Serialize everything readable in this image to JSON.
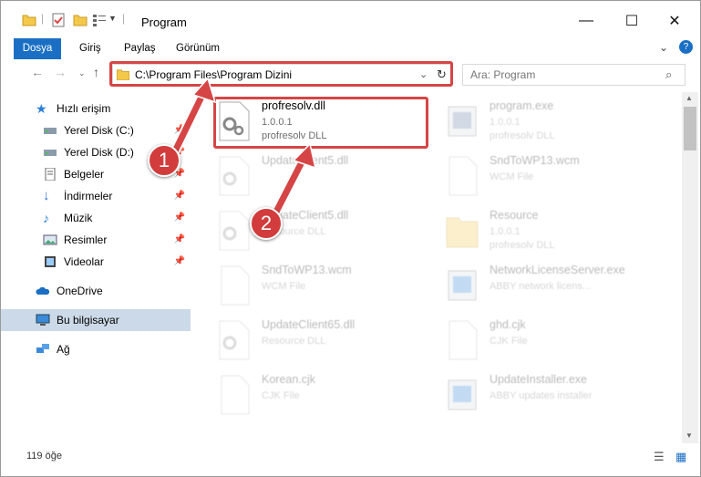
{
  "window": {
    "title": "Program",
    "controls": {
      "minimize": "—",
      "maximize": "☐",
      "close": "✕"
    }
  },
  "ribbon": {
    "tabs": [
      "Dosya",
      "Giriş",
      "Paylaş",
      "Görünüm"
    ],
    "expand_icon": "chevron-down-icon",
    "help_icon": "help-icon"
  },
  "address": {
    "path": "C:\\Program Files\\Program Dizini",
    "search_placeholder": "Ara: Program"
  },
  "nav": {
    "items": [
      {
        "label": "Hızlı erişim",
        "icon": "star-icon",
        "pinned": false
      },
      {
        "label": "Yerel Disk (C:)",
        "icon": "drive-icon",
        "pinned": true
      },
      {
        "label": "Yerel Disk (D:)",
        "icon": "drive-icon",
        "pinned": true
      },
      {
        "label": "Belgeler",
        "icon": "documents-icon",
        "pinned": true
      },
      {
        "label": "İndirmeler",
        "icon": "download-icon",
        "pinned": true
      },
      {
        "label": "Müzik",
        "icon": "music-icon",
        "pinned": true
      },
      {
        "label": "Resimler",
        "icon": "pictures-icon",
        "pinned": true
      },
      {
        "label": "Videolar",
        "icon": "videos-icon",
        "pinned": true
      },
      {
        "label": "OneDrive",
        "icon": "cloud-icon",
        "pinned": false
      },
      {
        "label": "Bu bilgisayar",
        "icon": "computer-icon",
        "pinned": false,
        "selected": true
      },
      {
        "label": "Ağ",
        "icon": "network-icon",
        "pinned": false
      }
    ]
  },
  "files": {
    "highlighted": {
      "name": "profresolv.dll",
      "version": "1.0.0.1",
      "desc": "profresolv DLL"
    },
    "others": [
      {
        "name": "program.exe",
        "line2": "1.0.0.1",
        "line3": "profresolv DLL"
      },
      {
        "name": "UpdateClient5.dll",
        "line2": "",
        "line3": ""
      },
      {
        "name": "SndToWP13.wcm",
        "line2": "WCM File",
        "line3": ""
      },
      {
        "name": "UpdateClient5.dll",
        "line2": "Resource DLL",
        "line3": ""
      },
      {
        "name": "Resource",
        "line2": "1.0.0.1",
        "line3": "profresolv DLL"
      },
      {
        "name": "SndToWP13.wcm",
        "line2": "WCM File",
        "line3": ""
      },
      {
        "name": "NetworkLicenseServer.exe",
        "line2": "ABBY network licens...",
        "line3": ""
      },
      {
        "name": "UpdateClient65.dll",
        "line2": "Resource DLL",
        "line3": ""
      },
      {
        "name": "ghd.cjk",
        "line2": "CJK File",
        "line3": ""
      },
      {
        "name": "Korean.cjk",
        "line2": "CJK File",
        "line3": ""
      },
      {
        "name": "UpdateInstaller.exe",
        "line2": "ABBY updates installer",
        "line3": ""
      }
    ]
  },
  "status": {
    "count": "119 öğe"
  },
  "annotations": {
    "badge1": "1",
    "badge2": "2"
  },
  "colors": {
    "accent": "#1a6fc4",
    "highlight": "#d64545",
    "selected": "#ccd9e8"
  }
}
